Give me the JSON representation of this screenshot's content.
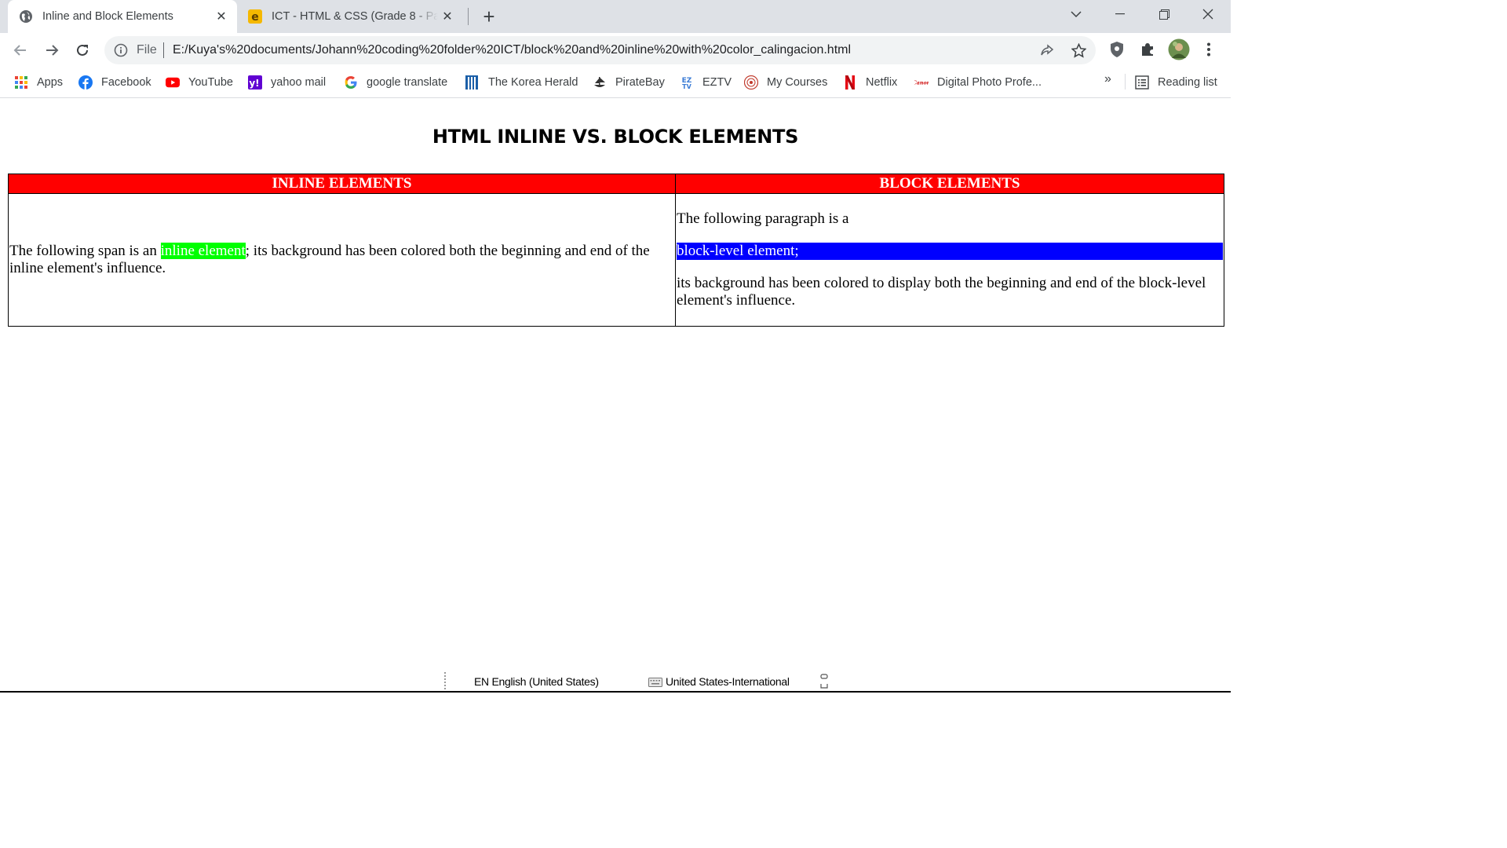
{
  "browser": {
    "tabs": [
      {
        "title": "Inline and Block Elements",
        "active": true,
        "favicon": "globe-icon"
      },
      {
        "title": "ICT - HTML & CSS (Grade 8 - Pas",
        "active": false,
        "favicon": "edmodo-icon"
      }
    ],
    "address": {
      "scheme_label": "File",
      "url": "E:/Kuya's%20documents/Johann%20coding%20folder%20ICT/block%20and%20inline%20with%20color_calingacion.html"
    },
    "bookmarks": [
      {
        "label": "Apps",
        "icon": "apps-grid-icon"
      },
      {
        "label": "Facebook",
        "icon": "facebook-icon"
      },
      {
        "label": "YouTube",
        "icon": "youtube-icon"
      },
      {
        "label": "yahoo mail",
        "icon": "yahoo-icon"
      },
      {
        "label": "google translate",
        "icon": "google-icon"
      },
      {
        "label": "The Korea Herald",
        "icon": "korea-herald-icon"
      },
      {
        "label": "PirateBay",
        "icon": "piratebay-icon"
      },
      {
        "label": "EZTV",
        "icon": "eztv-icon"
      },
      {
        "label": "My Courses",
        "icon": "my-courses-icon"
      },
      {
        "label": "Netflix",
        "icon": "netflix-icon"
      },
      {
        "label": "Digital Photo Profe...",
        "icon": "canon-icon"
      }
    ],
    "bookmarks_overflow": "»",
    "reading_list": "Reading list"
  },
  "page": {
    "heading": "HTML INLINE VS. BLOCK ELEMENTS",
    "table": {
      "headers": [
        "INLINE ELEMENTS",
        "BLOCK ELEMENTS"
      ],
      "inline_cell": {
        "before": "The following span is an ",
        "span": "inline element",
        "after": "; its background has been colored both the beginning and end of the inline element's influence."
      },
      "block_cell": {
        "p1": "The following paragraph is a",
        "p2": "block-level element;",
        "p3": "its background has been colored to display both the beginning and end of the block-level element's influence."
      }
    },
    "colors": {
      "header_bg": "#ff0000",
      "inline_bg": "#00ff00",
      "block_bg": "#0000ff"
    }
  },
  "taskbar": {
    "language": "EN English (United States)",
    "keyboard": "United States-International"
  }
}
